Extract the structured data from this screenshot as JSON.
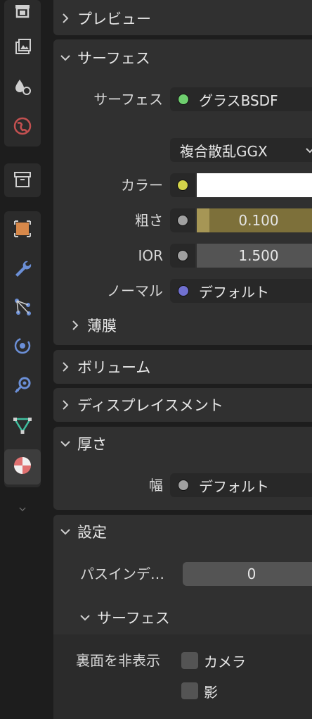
{
  "tabs": [
    {
      "name": "render-tab",
      "icon": "render-icon",
      "color": "#cfcfcf"
    },
    {
      "name": "output-tab",
      "icon": "output-icon",
      "color": "#cfcfcf"
    },
    {
      "name": "view-layer-tab",
      "icon": "view-layer-icon",
      "color": "#cfcfcf"
    },
    {
      "name": "world-tab",
      "icon": "world-icon",
      "color": "#c35050"
    },
    {
      "name": "collection-tab",
      "icon": "collection-icon",
      "color": "#cfcfcf"
    },
    {
      "name": "object-tab",
      "icon": "object-icon",
      "color": "#d7884a"
    },
    {
      "name": "modifier-tab",
      "icon": "wrench-icon",
      "color": "#6b8fd6"
    },
    {
      "name": "particles-tab",
      "icon": "particles-icon",
      "color": "#6b8fd6"
    },
    {
      "name": "physics-tab",
      "icon": "physics-icon",
      "color": "#6b8fd6"
    },
    {
      "name": "constraints-tab",
      "icon": "constraint-icon",
      "color": "#6b8fd6"
    },
    {
      "name": "data-tab",
      "icon": "mesh-data-icon",
      "color": "#3fbf9f"
    },
    {
      "name": "material-tab",
      "icon": "material-icon",
      "color": "#e07070"
    }
  ],
  "panels": {
    "preview": {
      "title": "プレビュー",
      "expanded": false
    },
    "surface": {
      "title": "サーフェス",
      "expanded": true,
      "surface_label": "サーフェス",
      "surface_value": "グラスBSDF",
      "surface_dot": "#6fcf6f",
      "distribution_value": "複合散乱GGX",
      "color_label": "カラー",
      "color_dot": "#d4d44a",
      "color_swatch": "#ffffff",
      "roughness_label": "粗さ",
      "roughness_value": "0.100",
      "roughness_fraction": 0.1,
      "roughness_dot": "#a0a0a0",
      "ior_label": "IOR",
      "ior_value": "1.500",
      "ior_dot": "#a0a0a0",
      "normal_label": "ノーマル",
      "normal_value": "デフォルト",
      "normal_dot": "#7070d0",
      "thinfilm_title": "薄膜"
    },
    "volume": {
      "title": "ボリューム",
      "expanded": false
    },
    "displacement": {
      "title": "ディスプレイスメント",
      "expanded": false
    },
    "thickness": {
      "title": "厚さ",
      "expanded": true,
      "width_label": "幅",
      "width_value": "デフォルト",
      "width_dot": "#a0a0a0"
    },
    "settings": {
      "title": "設定",
      "expanded": true,
      "pass_index_label": "パスインデ…",
      "pass_index_value": "0",
      "surface_sub_title": "サーフェス",
      "backface_label": "裏面を非表示",
      "camera_label": "カメラ",
      "shadow_label": "影"
    }
  }
}
